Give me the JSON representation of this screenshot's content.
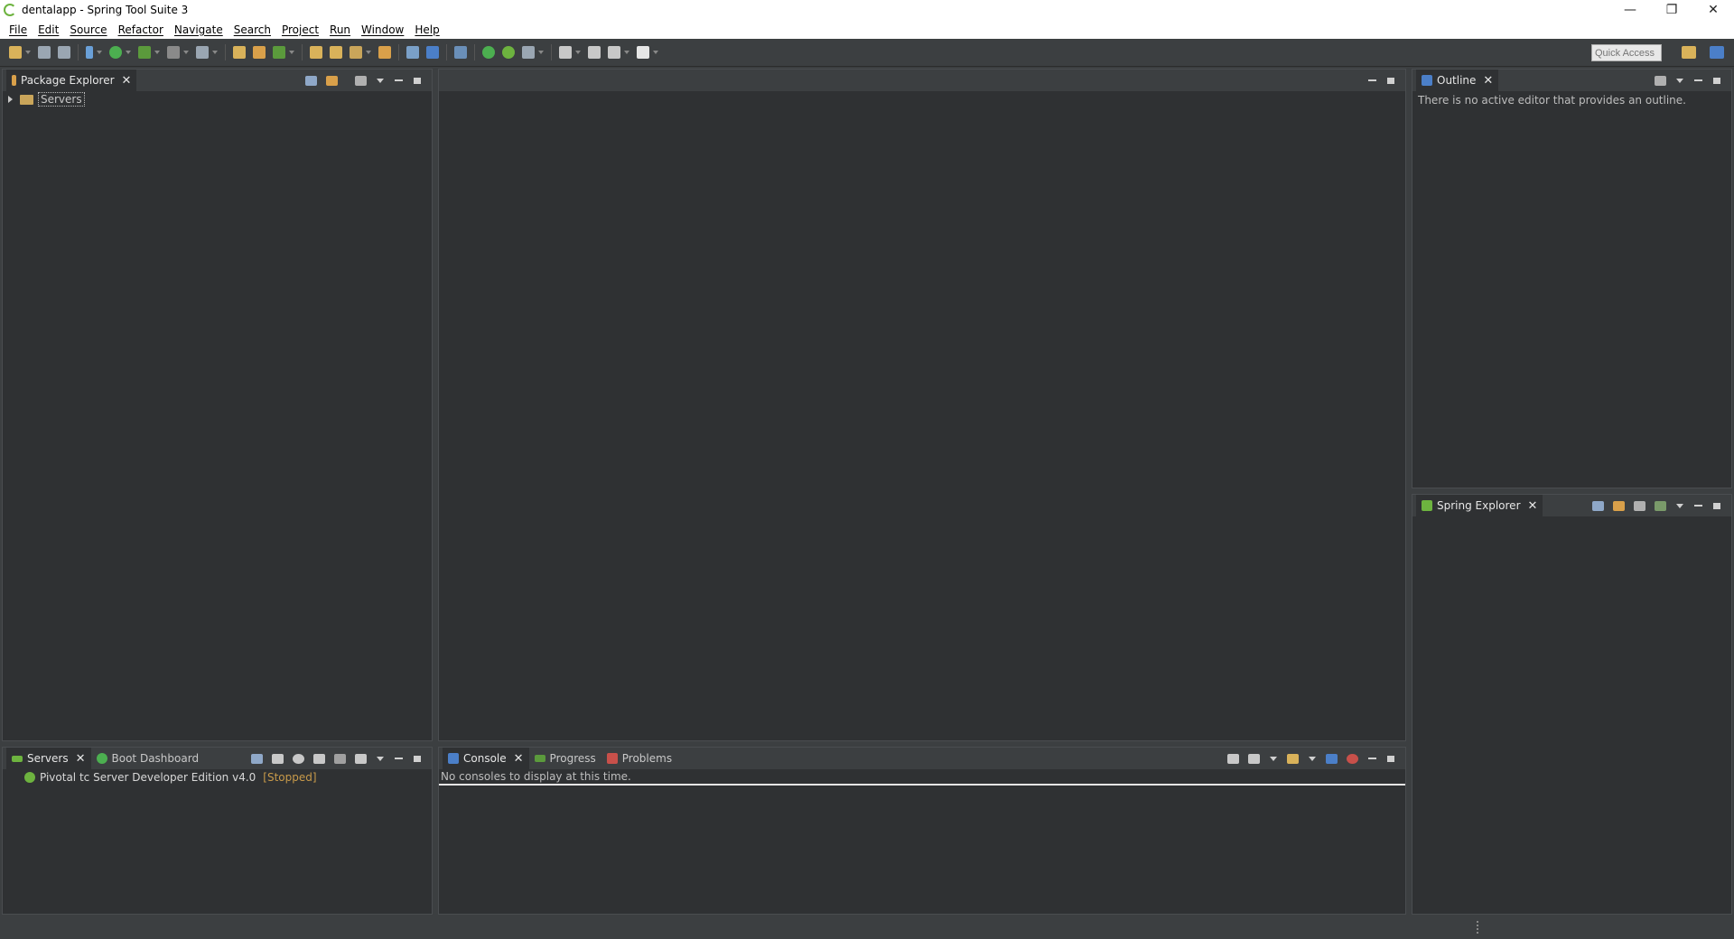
{
  "window": {
    "title": "dentalapp - Spring Tool Suite 3",
    "controls": {
      "minimize": "—",
      "restore": "❐",
      "close": "✕"
    }
  },
  "menu": [
    "File",
    "Edit",
    "Source",
    "Refactor",
    "Navigate",
    "Search",
    "Project",
    "Run",
    "Window",
    "Help"
  ],
  "toolbar": {
    "quick_access_placeholder": "Quick Access"
  },
  "package_explorer": {
    "tab": "Package Explorer",
    "tree": [
      {
        "label": "Servers",
        "icon": "folder-icon",
        "expanded": false
      }
    ]
  },
  "outline": {
    "tab": "Outline",
    "message": "There is no active editor that provides an outline."
  },
  "spring_explorer": {
    "tab": "Spring Explorer"
  },
  "bottom_left": {
    "tabs": [
      {
        "label": "Servers",
        "active": true,
        "closable": true
      },
      {
        "label": "Boot Dashboard",
        "active": false,
        "closable": false
      }
    ],
    "servers": [
      {
        "name": "Pivotal tc Server Developer Edition v4.0",
        "status": "[Stopped]"
      }
    ]
  },
  "bottom_center": {
    "tabs": [
      {
        "label": "Console",
        "active": true,
        "closable": true
      },
      {
        "label": "Progress",
        "active": false,
        "closable": false
      },
      {
        "label": "Problems",
        "active": false,
        "closable": false
      }
    ],
    "message": "No consoles to display at this time."
  },
  "colors": {
    "background": "#3c3f41",
    "panel": "#2f3133",
    "spring_green": "#6db33f",
    "stopped": "#c89a4a"
  }
}
